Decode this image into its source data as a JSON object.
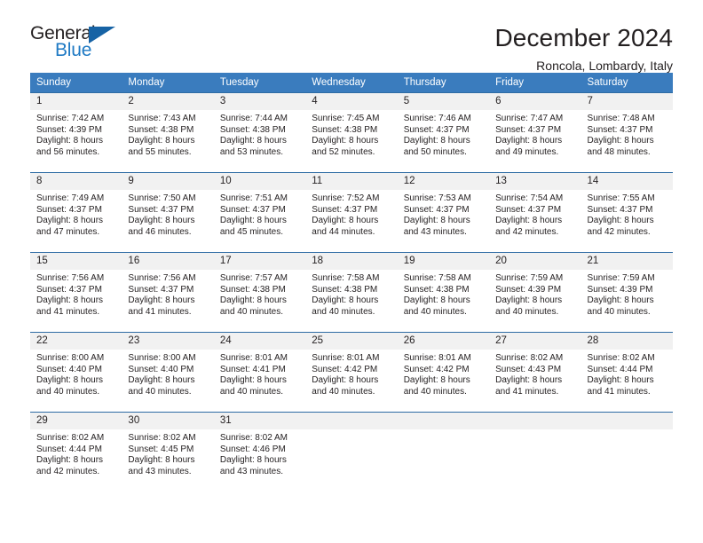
{
  "brand": {
    "name_top": "General",
    "name_bottom": "Blue",
    "triangle_icon": "blue-triangle-icon",
    "color_dark": "#231f20",
    "color_blue": "#1f7ac4"
  },
  "header": {
    "title": "December 2024",
    "subtitle": "Roncola, Lombardy, Italy"
  },
  "theme": {
    "header_row_bg": "#3a7cbe",
    "header_row_text": "#ffffff",
    "daynum_bg": "#f1f1f1",
    "row_border": "#2e6ca4",
    "body_text": "#231f20"
  },
  "weekday_headers": [
    "Sunday",
    "Monday",
    "Tuesday",
    "Wednesday",
    "Thursday",
    "Friday",
    "Saturday"
  ],
  "labels": {
    "sunrise": "Sunrise:",
    "sunset": "Sunset:",
    "daylight": "Daylight:"
  },
  "weeks": [
    [
      {
        "day": "1",
        "sunrise": "Sunrise: 7:42 AM",
        "sunset": "Sunset: 4:39 PM",
        "daylight_1": "Daylight: 8 hours",
        "daylight_2": "and 56 minutes."
      },
      {
        "day": "2",
        "sunrise": "Sunrise: 7:43 AM",
        "sunset": "Sunset: 4:38 PM",
        "daylight_1": "Daylight: 8 hours",
        "daylight_2": "and 55 minutes."
      },
      {
        "day": "3",
        "sunrise": "Sunrise: 7:44 AM",
        "sunset": "Sunset: 4:38 PM",
        "daylight_1": "Daylight: 8 hours",
        "daylight_2": "and 53 minutes."
      },
      {
        "day": "4",
        "sunrise": "Sunrise: 7:45 AM",
        "sunset": "Sunset: 4:38 PM",
        "daylight_1": "Daylight: 8 hours",
        "daylight_2": "and 52 minutes."
      },
      {
        "day": "5",
        "sunrise": "Sunrise: 7:46 AM",
        "sunset": "Sunset: 4:37 PM",
        "daylight_1": "Daylight: 8 hours",
        "daylight_2": "and 50 minutes."
      },
      {
        "day": "6",
        "sunrise": "Sunrise: 7:47 AM",
        "sunset": "Sunset: 4:37 PM",
        "daylight_1": "Daylight: 8 hours",
        "daylight_2": "and 49 minutes."
      },
      {
        "day": "7",
        "sunrise": "Sunrise: 7:48 AM",
        "sunset": "Sunset: 4:37 PM",
        "daylight_1": "Daylight: 8 hours",
        "daylight_2": "and 48 minutes."
      }
    ],
    [
      {
        "day": "8",
        "sunrise": "Sunrise: 7:49 AM",
        "sunset": "Sunset: 4:37 PM",
        "daylight_1": "Daylight: 8 hours",
        "daylight_2": "and 47 minutes."
      },
      {
        "day": "9",
        "sunrise": "Sunrise: 7:50 AM",
        "sunset": "Sunset: 4:37 PM",
        "daylight_1": "Daylight: 8 hours",
        "daylight_2": "and 46 minutes."
      },
      {
        "day": "10",
        "sunrise": "Sunrise: 7:51 AM",
        "sunset": "Sunset: 4:37 PM",
        "daylight_1": "Daylight: 8 hours",
        "daylight_2": "and 45 minutes."
      },
      {
        "day": "11",
        "sunrise": "Sunrise: 7:52 AM",
        "sunset": "Sunset: 4:37 PM",
        "daylight_1": "Daylight: 8 hours",
        "daylight_2": "and 44 minutes."
      },
      {
        "day": "12",
        "sunrise": "Sunrise: 7:53 AM",
        "sunset": "Sunset: 4:37 PM",
        "daylight_1": "Daylight: 8 hours",
        "daylight_2": "and 43 minutes."
      },
      {
        "day": "13",
        "sunrise": "Sunrise: 7:54 AM",
        "sunset": "Sunset: 4:37 PM",
        "daylight_1": "Daylight: 8 hours",
        "daylight_2": "and 42 minutes."
      },
      {
        "day": "14",
        "sunrise": "Sunrise: 7:55 AM",
        "sunset": "Sunset: 4:37 PM",
        "daylight_1": "Daylight: 8 hours",
        "daylight_2": "and 42 minutes."
      }
    ],
    [
      {
        "day": "15",
        "sunrise": "Sunrise: 7:56 AM",
        "sunset": "Sunset: 4:37 PM",
        "daylight_1": "Daylight: 8 hours",
        "daylight_2": "and 41 minutes."
      },
      {
        "day": "16",
        "sunrise": "Sunrise: 7:56 AM",
        "sunset": "Sunset: 4:37 PM",
        "daylight_1": "Daylight: 8 hours",
        "daylight_2": "and 41 minutes."
      },
      {
        "day": "17",
        "sunrise": "Sunrise: 7:57 AM",
        "sunset": "Sunset: 4:38 PM",
        "daylight_1": "Daylight: 8 hours",
        "daylight_2": "and 40 minutes."
      },
      {
        "day": "18",
        "sunrise": "Sunrise: 7:58 AM",
        "sunset": "Sunset: 4:38 PM",
        "daylight_1": "Daylight: 8 hours",
        "daylight_2": "and 40 minutes."
      },
      {
        "day": "19",
        "sunrise": "Sunrise: 7:58 AM",
        "sunset": "Sunset: 4:38 PM",
        "daylight_1": "Daylight: 8 hours",
        "daylight_2": "and 40 minutes."
      },
      {
        "day": "20",
        "sunrise": "Sunrise: 7:59 AM",
        "sunset": "Sunset: 4:39 PM",
        "daylight_1": "Daylight: 8 hours",
        "daylight_2": "and 40 minutes."
      },
      {
        "day": "21",
        "sunrise": "Sunrise: 7:59 AM",
        "sunset": "Sunset: 4:39 PM",
        "daylight_1": "Daylight: 8 hours",
        "daylight_2": "and 40 minutes."
      }
    ],
    [
      {
        "day": "22",
        "sunrise": "Sunrise: 8:00 AM",
        "sunset": "Sunset: 4:40 PM",
        "daylight_1": "Daylight: 8 hours",
        "daylight_2": "and 40 minutes."
      },
      {
        "day": "23",
        "sunrise": "Sunrise: 8:00 AM",
        "sunset": "Sunset: 4:40 PM",
        "daylight_1": "Daylight: 8 hours",
        "daylight_2": "and 40 minutes."
      },
      {
        "day": "24",
        "sunrise": "Sunrise: 8:01 AM",
        "sunset": "Sunset: 4:41 PM",
        "daylight_1": "Daylight: 8 hours",
        "daylight_2": "and 40 minutes."
      },
      {
        "day": "25",
        "sunrise": "Sunrise: 8:01 AM",
        "sunset": "Sunset: 4:42 PM",
        "daylight_1": "Daylight: 8 hours",
        "daylight_2": "and 40 minutes."
      },
      {
        "day": "26",
        "sunrise": "Sunrise: 8:01 AM",
        "sunset": "Sunset: 4:42 PM",
        "daylight_1": "Daylight: 8 hours",
        "daylight_2": "and 40 minutes."
      },
      {
        "day": "27",
        "sunrise": "Sunrise: 8:02 AM",
        "sunset": "Sunset: 4:43 PM",
        "daylight_1": "Daylight: 8 hours",
        "daylight_2": "and 41 minutes."
      },
      {
        "day": "28",
        "sunrise": "Sunrise: 8:02 AM",
        "sunset": "Sunset: 4:44 PM",
        "daylight_1": "Daylight: 8 hours",
        "daylight_2": "and 41 minutes."
      }
    ],
    [
      {
        "day": "29",
        "sunrise": "Sunrise: 8:02 AM",
        "sunset": "Sunset: 4:44 PM",
        "daylight_1": "Daylight: 8 hours",
        "daylight_2": "and 42 minutes."
      },
      {
        "day": "30",
        "sunrise": "Sunrise: 8:02 AM",
        "sunset": "Sunset: 4:45 PM",
        "daylight_1": "Daylight: 8 hours",
        "daylight_2": "and 43 minutes."
      },
      {
        "day": "31",
        "sunrise": "Sunrise: 8:02 AM",
        "sunset": "Sunset: 4:46 PM",
        "daylight_1": "Daylight: 8 hours",
        "daylight_2": "and 43 minutes."
      },
      {
        "day": "",
        "sunrise": "",
        "sunset": "",
        "daylight_1": "",
        "daylight_2": ""
      },
      {
        "day": "",
        "sunrise": "",
        "sunset": "",
        "daylight_1": "",
        "daylight_2": ""
      },
      {
        "day": "",
        "sunrise": "",
        "sunset": "",
        "daylight_1": "",
        "daylight_2": ""
      },
      {
        "day": "",
        "sunrise": "",
        "sunset": "",
        "daylight_1": "",
        "daylight_2": ""
      }
    ]
  ]
}
